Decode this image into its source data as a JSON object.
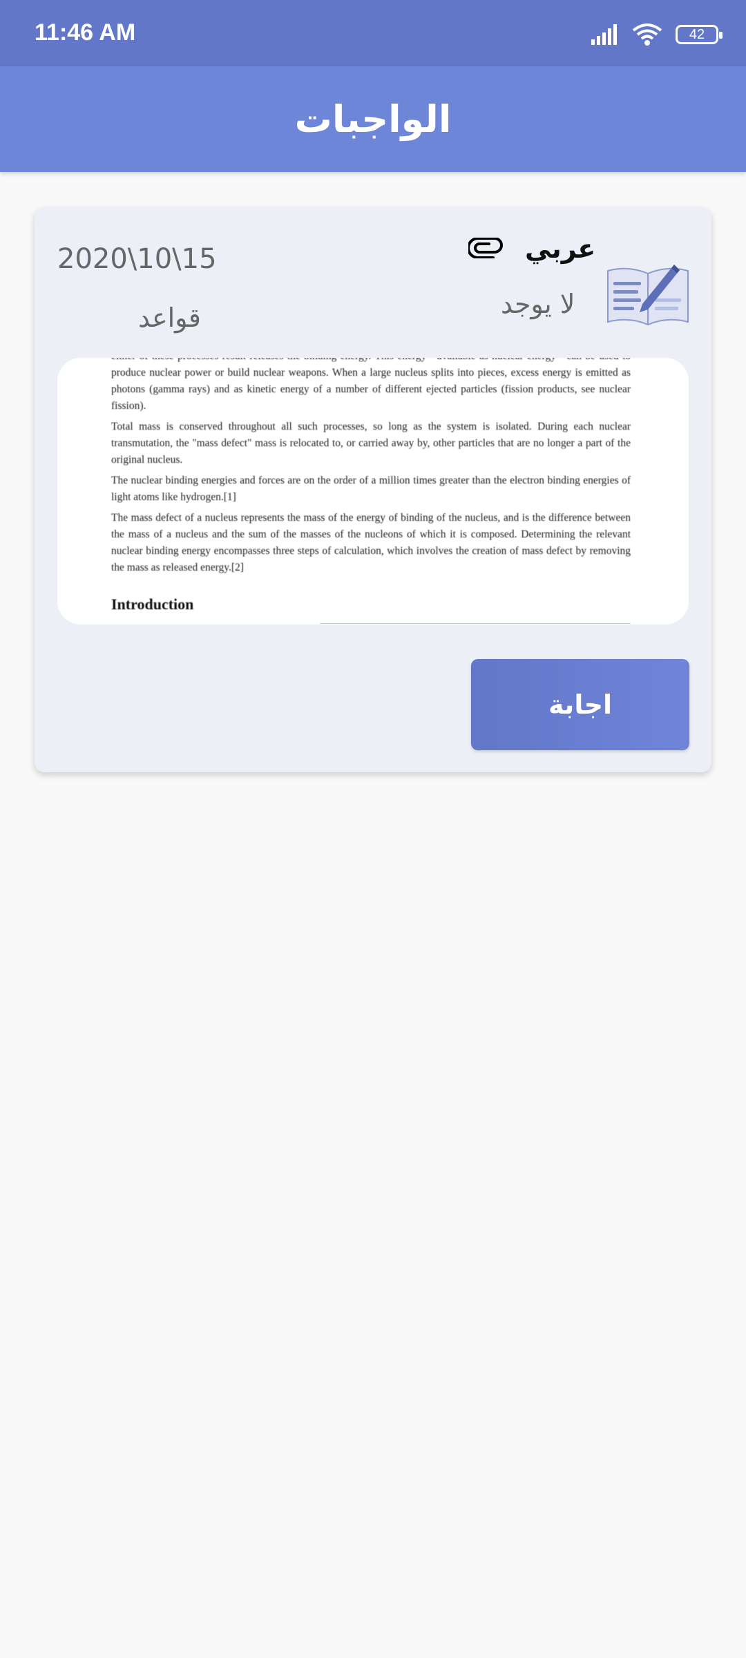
{
  "status_bar": {
    "time": "11:46 AM",
    "battery": "42",
    "icons": [
      "signal-icon",
      "wifi-icon",
      "battery-icon"
    ]
  },
  "app_bar": {
    "title": "الواجبات"
  },
  "homework_card": {
    "date": "2020\\10\\15",
    "lesson": "قواعد",
    "subject": "عربي",
    "attachment_status": "لا يوجد",
    "document_preview": {
      "paragraphs": [
        "either of these processes result releases the binding energy. This energy—available as nuclear energy—can be used to produce nuclear power or build nuclear weapons. When a large nucleus splits into pieces, excess energy is emitted as photons (gamma rays) and as kinetic energy of a number of different ejected particles (fission products, see nuclear fission).",
        "Total mass is conserved throughout all such processes, so long as the system is isolated. During each nuclear transmutation, the \"mass defect\" mass is relocated to, or carried away by, other particles that are no longer a part of the original nucleus.",
        "The nuclear binding energies and forces are on the order of a million times greater than the electron binding energies of light atoms like hydrogen.[1]",
        "The mass defect of a nucleus represents the mass of the energy of binding of the nucleus, and is the difference between the mass of a nucleus and the sum of the masses of the nucleons of which it is composed. Determining the relevant nuclear binding energy encompasses three steps of calculation, which involves the creation of mass defect by removing the mass as released energy.[2]"
      ],
      "heading": "Introduction"
    },
    "answer_button": "اجابة"
  },
  "colors": {
    "status_bar": "#6277c8",
    "app_bar": "#6e86d8",
    "card_background": "#eceff5",
    "button": "#6a7fd2"
  }
}
